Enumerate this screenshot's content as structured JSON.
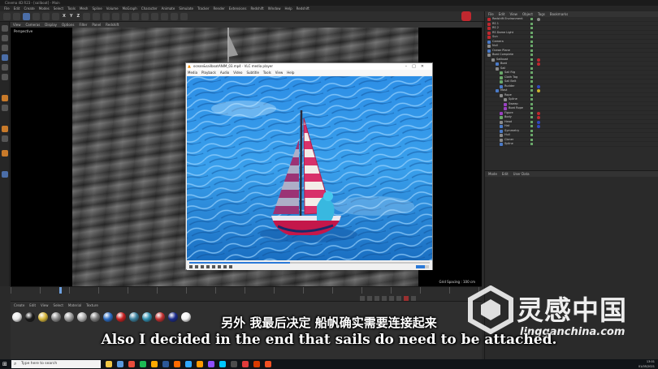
{
  "app": {
    "title": "Cinema 4D R23 - [sailboat] - Main",
    "menu": [
      "File",
      "Edit",
      "Create",
      "Modes",
      "Select",
      "Tools",
      "Mesh",
      "Spline",
      "Volume",
      "MoGraph",
      "Character",
      "Animate",
      "Simulate",
      "Tracker",
      "Render",
      "Extensions",
      "Redshift",
      "Window",
      "Help",
      "Redshift"
    ],
    "toolbar_xyz": [
      "X",
      "Y",
      "Z"
    ]
  },
  "viewport": {
    "menu": [
      "View",
      "Cameras",
      "Display",
      "Options",
      "Filter",
      "Panel",
      "Redshift"
    ],
    "label": "Perspective",
    "grid_spacing": "Grid Spacing : 100 cm"
  },
  "timeline": {
    "current_frame": "0 F"
  },
  "materials": {
    "menu": [
      "Create",
      "Edit",
      "View",
      "Select",
      "Material",
      "Texture"
    ],
    "swatches": [
      "#e9e9e9",
      "#1a1a1a",
      "#d6b63a",
      "#8a8a8a",
      "#9c9c9c",
      "#b0b0b0",
      "#7a7a7a",
      "#2b6cc4",
      "#c82020",
      "#3a7f9c",
      "#2f8fb0",
      "#c23030",
      "#1a2a8a",
      "#f2f2f2"
    ]
  },
  "objects": {
    "menu": [
      "File",
      "Edit",
      "View",
      "Object",
      "Tags",
      "Bookmarks"
    ],
    "rows": [
      {
        "name": "Redshift Environment",
        "indent": 0,
        "color": "#c0282f",
        "tag": "#888"
      },
      {
        "name": "RS 1",
        "indent": 0,
        "color": "#c0282f",
        "tag": ""
      },
      {
        "name": "RS 2",
        "indent": 0,
        "color": "#c0282f",
        "tag": ""
      },
      {
        "name": "RS Dome Light",
        "indent": 0,
        "color": "#c0282f",
        "tag": ""
      },
      {
        "name": "Sun",
        "indent": 0,
        "color": "#c0282f",
        "tag": ""
      },
      {
        "name": "Camera",
        "indent": 0,
        "color": "#4a7ac8",
        "tag": ""
      },
      {
        "name": "Null",
        "indent": 0,
        "color": "#8a8a8a",
        "tag": ""
      },
      {
        "name": "Ocean Plane",
        "indent": 0,
        "color": "#4a7ac8",
        "tag": ""
      },
      {
        "name": "Boat Complete",
        "indent": 0,
        "color": "#8a8a8a",
        "tag": ""
      },
      {
        "name": "Sailboat",
        "indent": 1,
        "color": "#8a8a8a",
        "tag": "#c0282f"
      },
      {
        "name": "Boat",
        "indent": 2,
        "color": "#4a7ac8",
        "tag": "#c0282f"
      },
      {
        "name": "Sail",
        "indent": 2,
        "color": "#8a8a8a",
        "tag": ""
      },
      {
        "name": "Sail Rig",
        "indent": 3,
        "color": "#6aa86a",
        "tag": ""
      },
      {
        "name": "Cloth Tag",
        "indent": 3,
        "color": "#6aa86a",
        "tag": ""
      },
      {
        "name": "Sail Belt",
        "indent": 3,
        "color": "#6aa86a",
        "tag": ""
      },
      {
        "name": "Rudder",
        "indent": 3,
        "color": "#4a7ac8",
        "tag": "#3048c0"
      },
      {
        "name": "Mast",
        "indent": 2,
        "color": "#4a7ac8",
        "tag": "#c8b030"
      },
      {
        "name": "Rope",
        "indent": 3,
        "color": "#8a8a8a",
        "tag": ""
      },
      {
        "name": "Spline",
        "indent": 4,
        "color": "#8a8a8a",
        "tag": ""
      },
      {
        "name": "Sweep",
        "indent": 4,
        "color": "#9a40c0",
        "tag": ""
      },
      {
        "name": "Boat Rope",
        "indent": 4,
        "color": "#9a40c0",
        "tag": ""
      },
      {
        "name": "Figure",
        "indent": 3,
        "color": "#9a40c0",
        "tag": "#c0282f"
      },
      {
        "name": "Body",
        "indent": 3,
        "color": "#6aa86a",
        "tag": "#c0282f"
      },
      {
        "name": "Head",
        "indent": 3,
        "color": "#8a8a8a",
        "tag": "#3048c0"
      },
      {
        "name": "Hat",
        "indent": 3,
        "color": "#4a7ac8",
        "tag": "#3048c0"
      },
      {
        "name": "Symmetry",
        "indent": 3,
        "color": "#4a7ac8",
        "tag": ""
      },
      {
        "name": "Hull",
        "indent": 3,
        "color": "#8a8a8a",
        "tag": ""
      },
      {
        "name": "Cloner",
        "indent": 3,
        "color": "#8a8a8a",
        "tag": ""
      },
      {
        "name": "Spline",
        "indent": 3,
        "color": "#4a7ac8",
        "tag": ""
      }
    ]
  },
  "attributes": {
    "menu": [
      "Mode",
      "Edit",
      "User Data"
    ]
  },
  "vlc": {
    "title": "ocean&sailboatANIM_03.mp4 - VLC media player",
    "menu": [
      "Media",
      "Playback",
      "Audio",
      "Video",
      "Subtitle",
      "Tools",
      "View",
      "Help"
    ],
    "progress": 0.42
  },
  "subtitles": {
    "cn": "另外 我最后决定 船帆确实需要连接起来",
    "en": "Also I decided in the end that sails do need to be attached."
  },
  "watermark": {
    "cn": "灵感中国",
    "en": "lingganchina.com"
  },
  "taskbar": {
    "search_placeholder": "Type here to search",
    "time": "13:01",
    "date": "01/05/2021",
    "apps": [
      "#f2c744",
      "#5a9adf",
      "#e74c3c",
      "#1db954",
      "#ffaa00",
      "#2b5797",
      "#ff6a00",
      "#31a8ff",
      "#ff9a00",
      "#8f4fff",
      "#00c8ff",
      "#4c4c4c",
      "#e03a3a",
      "#d83b01",
      "#f25022"
    ]
  }
}
